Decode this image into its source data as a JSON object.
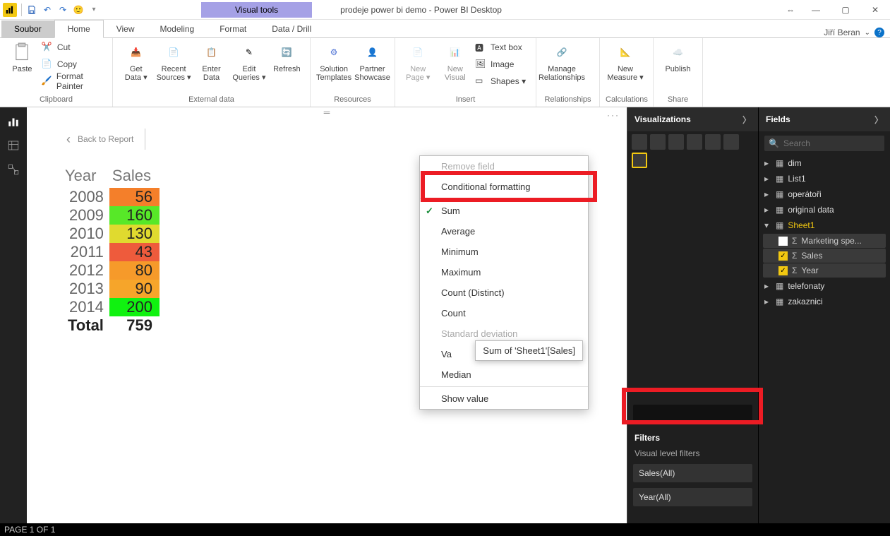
{
  "title": "prodeje power bi demo - Power BI Desktop",
  "contextual_tab": "Visual tools",
  "user": "Jiří Beran",
  "tabs": {
    "file": "Soubor",
    "home": "Home",
    "view": "View",
    "modeling": "Modeling",
    "format": "Format",
    "datadrill": "Data / Drill"
  },
  "ribbon": {
    "clipboard": {
      "paste": "Paste",
      "cut": "Cut",
      "copy": "Copy",
      "fmtpainter": "Format Painter",
      "label": "Clipboard"
    },
    "external": {
      "getdata": "Get\nData ▾",
      "recent": "Recent\nSources ▾",
      "enter": "Enter\nData",
      "edit": "Edit\nQueries ▾",
      "refresh": "Refresh",
      "label": "External data"
    },
    "resources": {
      "sol": "Solution\nTemplates",
      "partner": "Partner\nShowcase",
      "label": "Resources"
    },
    "insert": {
      "newpage": "New\nPage ▾",
      "newvisual": "New\nVisual",
      "textbox": "Text box",
      "image": "Image",
      "shapes": "Shapes ▾",
      "label": "Insert"
    },
    "rel": {
      "manage": "Manage\nRelationships",
      "label": "Relationships"
    },
    "calc": {
      "newmeasure": "New\nMeasure ▾",
      "label": "Calculations"
    },
    "share": {
      "publish": "Publish",
      "label": "Share"
    }
  },
  "canvas": {
    "back": "Back to Report"
  },
  "matrix": {
    "headers": [
      "Year",
      "Sales"
    ],
    "rows": [
      {
        "year": "2008",
        "sales": "56",
        "bg": "#f47f2a"
      },
      {
        "year": "2009",
        "sales": "160",
        "bg": "#57e828"
      },
      {
        "year": "2010",
        "sales": "130",
        "bg": "#e0da2f"
      },
      {
        "year": "2011",
        "sales": "43",
        "bg": "#ee5b3c"
      },
      {
        "year": "2012",
        "sales": "80",
        "bg": "#f69a2a"
      },
      {
        "year": "2013",
        "sales": "90",
        "bg": "#f6a52a"
      },
      {
        "year": "2014",
        "sales": "200",
        "bg": "#10f210"
      }
    ],
    "total_label": "Total",
    "total_value": "759"
  },
  "context_menu": {
    "remove": "Remove field",
    "cond": "Conditional formatting",
    "sum": "Sum",
    "avg": "Average",
    "min": "Minimum",
    "max": "Maximum",
    "countd": "Count (Distinct)",
    "count": "Count",
    "std": "Standard deviation",
    "var": "Va",
    "median": "Median",
    "showas": "Show value"
  },
  "tooltip": "Sum of 'Sheet1'[Sales]",
  "viz_pane": {
    "title": "Visualizations",
    "filters": "Filters",
    "vlf": "Visual level filters",
    "f1": "Sales(All)",
    "f2": "Year(All)"
  },
  "fields_pane": {
    "title": "Fields",
    "search": "Search",
    "tables": [
      "dim",
      "List1",
      "operátoři",
      "original data"
    ],
    "open": "Sheet1",
    "checks": [
      {
        "name": "Marketing spe...",
        "checked": false
      },
      {
        "name": "Sales",
        "checked": true
      },
      {
        "name": "Year",
        "checked": true
      }
    ],
    "rest": [
      "telefonaty",
      "zakaznici"
    ]
  },
  "status": "PAGE 1 OF 1"
}
